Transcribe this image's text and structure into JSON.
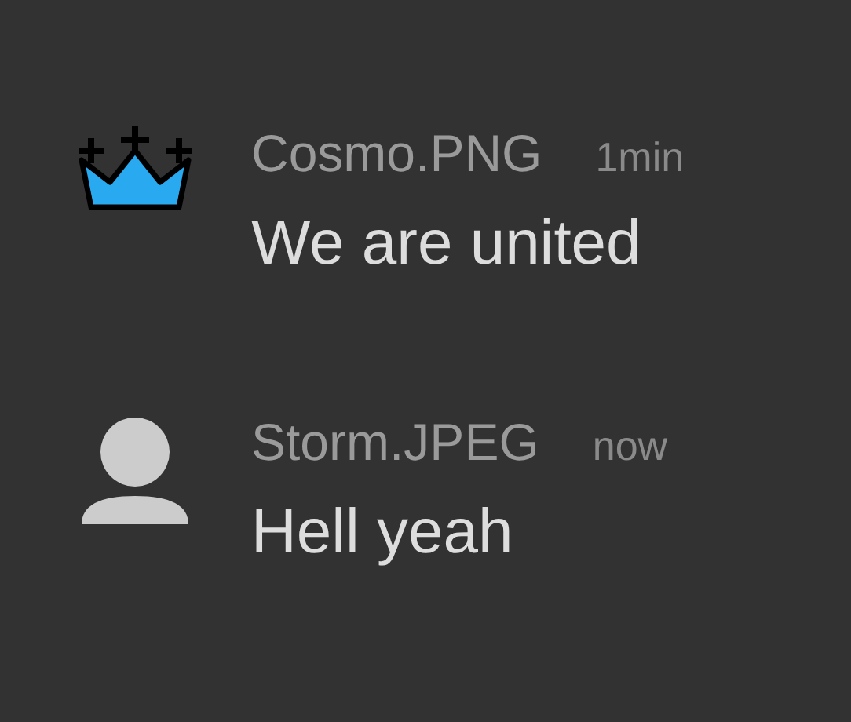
{
  "messages": [
    {
      "kind": "crown",
      "author": "Cosmo.PNG",
      "time": "1min",
      "text": "We are united"
    },
    {
      "kind": "default",
      "author": "Storm.JPEG",
      "time": "now",
      "text": "Hell yeah"
    }
  ]
}
